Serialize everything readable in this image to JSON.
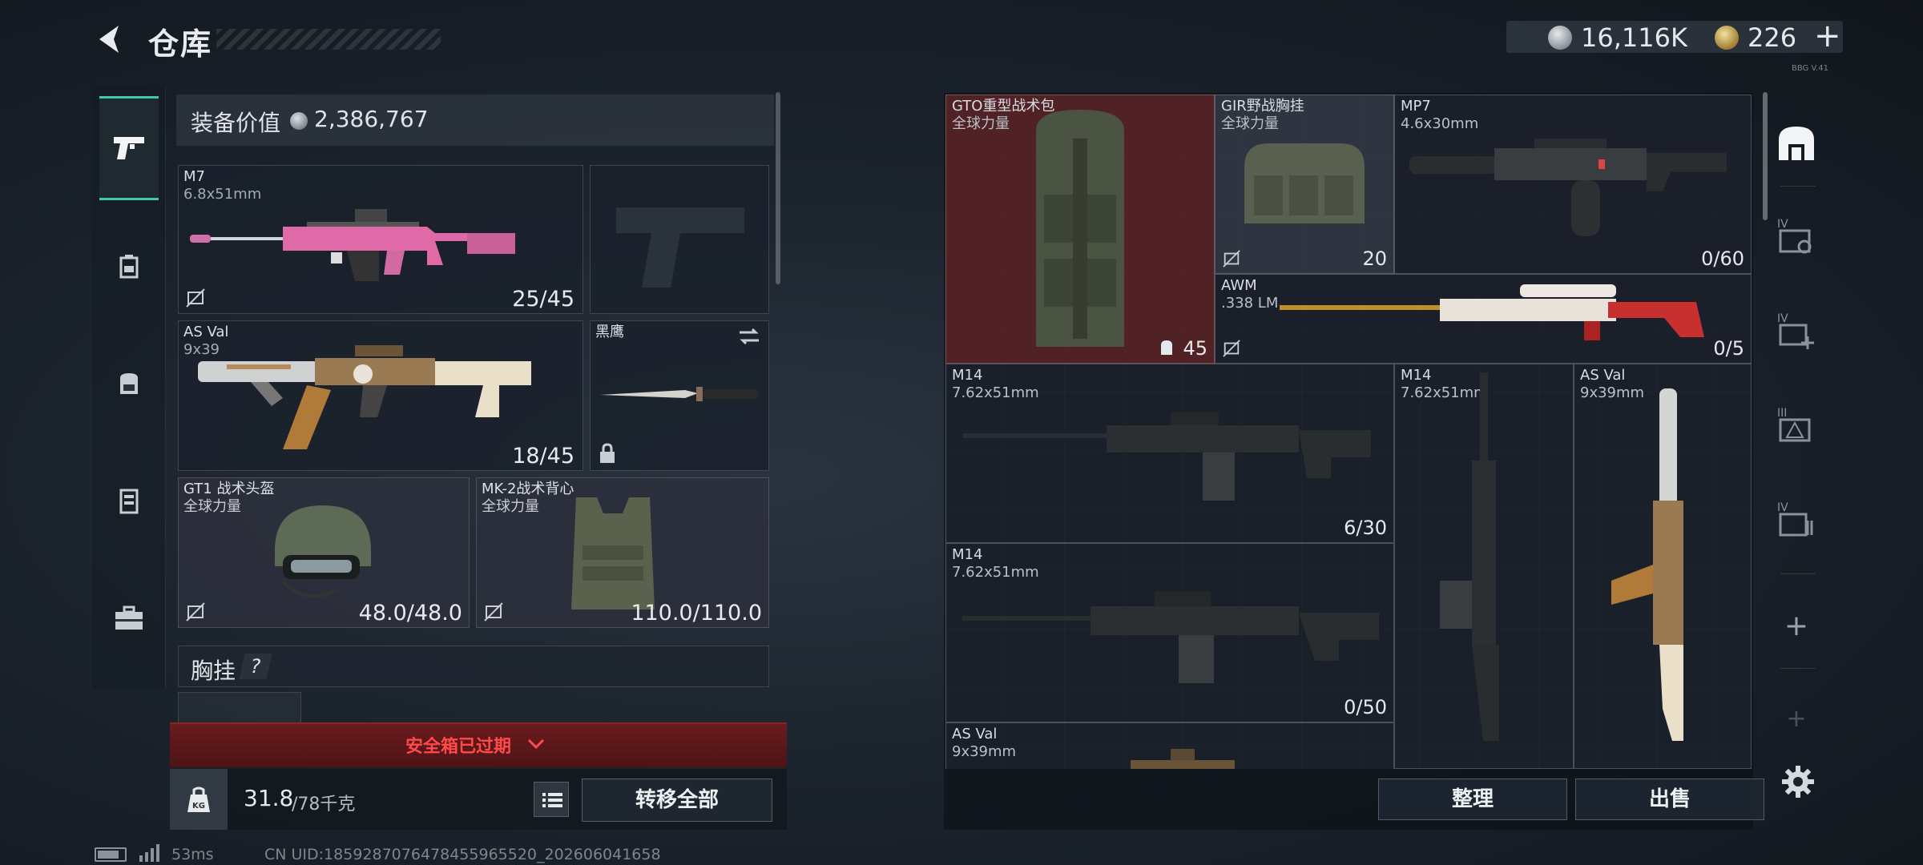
{
  "header": {
    "title": "仓库",
    "currency1": "16,116K",
    "currency2": "226",
    "currency2_plus": "+",
    "tiny_note": "BBG V.41"
  },
  "sidebar": {
    "items": [
      {
        "name": "pistol-icon",
        "active": true
      },
      {
        "name": "backpack-small-icon",
        "active": false
      },
      {
        "name": "backpack-icon",
        "active": false
      },
      {
        "name": "locker-icon",
        "active": false
      },
      {
        "name": "briefcase-icon",
        "active": false
      }
    ]
  },
  "loadout": {
    "value_label": "装备价值",
    "value": "2,386,767",
    "primary1": {
      "name": "M7",
      "caliber": "6.8x51mm",
      "count": "25/45"
    },
    "primary2": {
      "name": "AS Val",
      "caliber": "9x39",
      "count": "18/45"
    },
    "melee": {
      "name": "黑鹰"
    },
    "helmet": {
      "name": "GT1 战术头盔",
      "sub": "全球力量",
      "durability": "48.0/48.0"
    },
    "armor": {
      "name": "MK-2战术背心",
      "sub": "全球力量",
      "durability": "110.0/110.0"
    },
    "vest_label": "胸挂",
    "vest_help": "?",
    "expired": "安全箱已过期",
    "weight_current": "31.8",
    "weight_max": "/78千克",
    "kg_label": "KG",
    "transfer_all": "转移全部"
  },
  "status": {
    "ping": "53ms",
    "uid": "CN UID:1859287076478455965520_202606041658"
  },
  "storage": {
    "items": [
      {
        "name": "GTO重型战术包",
        "sub": "全球力量",
        "count": "45"
      },
      {
        "name": "GIR野战胸挂",
        "sub": "全球力量",
        "count": "20"
      },
      {
        "name": "MP7",
        "sub": "4.6x30mm",
        "count": "0/60"
      },
      {
        "name": "AWM",
        "sub": ".338 LM",
        "count": "0/5"
      },
      {
        "name": "M14",
        "sub": "7.62x51mm",
        "count": "6/30"
      },
      {
        "name": "M14",
        "sub": "7.62x51mm",
        "count": ""
      },
      {
        "name": "AS Val",
        "sub": "9x39mm",
        "count": ""
      },
      {
        "name": "M14",
        "sub": "7.62x51mm",
        "count": "0/50"
      },
      {
        "name": "AS Val",
        "sub": "9x39mm",
        "count": ""
      }
    ],
    "sort_label": "整理",
    "sell_label": "出售"
  },
  "right_tabs": {
    "tier_labels": [
      "IV",
      "IV",
      "III",
      "IV"
    ],
    "add": "+"
  },
  "colors": {
    "accent_teal": "#3fc9a6",
    "expired_red": "#ff4a4a",
    "highlight_red_cell": "#5a2327",
    "m7_pink": "#e06aa8"
  }
}
